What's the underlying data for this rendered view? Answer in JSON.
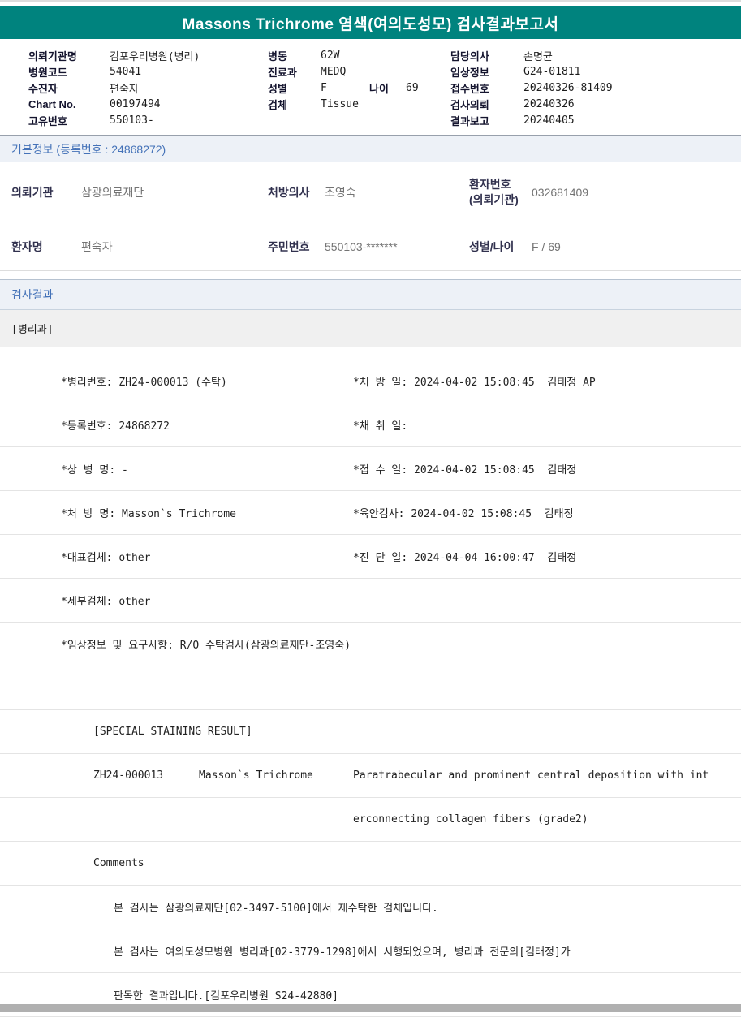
{
  "title": "Massons Trichrome 염색(여의도성모) 검사결과보고서",
  "colors": {
    "banner_teal": "#00837E",
    "section_blue": "#4472B8"
  },
  "header": {
    "left": [
      {
        "label": "의뢰기관명",
        "value": "김포우리병원(병리)"
      },
      {
        "label": "병원코드",
        "value": "54041"
      },
      {
        "label": "수진자",
        "value": "편숙자"
      },
      {
        "label": "Chart No.",
        "value": "00197494"
      },
      {
        "label": "고유번호",
        "value": "550103-"
      }
    ],
    "middle": [
      {
        "label": "병동",
        "value": "62W"
      },
      {
        "label": "진료과",
        "value": "MEDQ"
      },
      {
        "label": "성별",
        "value": "F",
        "label2": "나이",
        "value2": "69"
      },
      {
        "label": "검체",
        "value": "Tissue"
      }
    ],
    "right": [
      {
        "label": "담당의사",
        "value": "손명균"
      },
      {
        "label": "임상정보",
        "value": "G24-01811"
      },
      {
        "label": "접수번호",
        "value": "20240326-81409"
      },
      {
        "label": "검사의뢰",
        "value": "20240326"
      },
      {
        "label": "결과보고",
        "value": "20240405"
      }
    ]
  },
  "basic_info": {
    "section_title": "기본정보 (등록번호 : 24868272)",
    "rows": [
      [
        {
          "label": "의뢰기관",
          "value": "삼광의료재단"
        },
        {
          "label": "처방의사",
          "value": "조영숙"
        },
        {
          "label": "환자번호\n(의뢰기관)",
          "value": "032681409"
        }
      ],
      [
        {
          "label": "환자명",
          "value": "편숙자"
        },
        {
          "label": "주민번호",
          "value": "550103-*******"
        },
        {
          "label": "성별/나이",
          "value": "F / 69"
        }
      ]
    ]
  },
  "results": {
    "section_title": "검사결과",
    "department": "[병리과]",
    "rows": [
      {
        "left": "*병리번호: ZH24-000013 (수탁)",
        "right": "*처 방 일: 2024-04-02 15:08:45  김태정 AP"
      },
      {
        "left": "*등록번호: 24868272",
        "right": "*채 취 일:"
      },
      {
        "left": "*상 병 명: -",
        "right": "*접 수 일: 2024-04-02 15:08:45  김태정"
      },
      {
        "left": "*처 방 명: Masson`s Trichrome",
        "right": "*육안검사: 2024-04-02 15:08:45  김태정"
      },
      {
        "left": "*대표검체: other",
        "right": "*진 단 일: 2024-04-04 16:00:47  김태정"
      },
      {
        "left": "*세부검체: other",
        "right": ""
      },
      {
        "full": "*임상정보 및 요구사항: R/O 수탁검사(삼광의료재단-조영숙)"
      },
      {
        "full": ""
      },
      {
        "full": "[SPECIAL STAINING RESULT]"
      },
      {
        "c1": "ZH24-000013",
        "c2": "Masson`s Trichrome",
        "c3": "Paratrabecular and prominent central deposition with int"
      },
      {
        "c3": "erconnecting collagen fibers (grade2)"
      },
      {
        "full": "Comments"
      },
      {
        "full": "본 검사는 삼광의료재단[02-3497-5100]에서 재수탁한 검체입니다."
      },
      {
        "full": "본 검사는 여의도성모병원 병리과[02-3779-1298]에서 시행되었으며, 병리과 전문의[김태정]가"
      },
      {
        "full": "판독한 결과입니다.[김포우리병원 S24-42880]"
      }
    ]
  }
}
